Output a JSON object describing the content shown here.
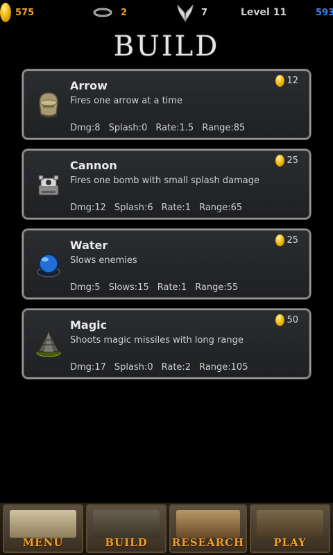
{
  "status": {
    "gold": "575",
    "rings": "2",
    "wings": "7",
    "level": "Level 11",
    "score": "593"
  },
  "page": {
    "title": "BUILD"
  },
  "towers": [
    {
      "name": "Arrow",
      "description": "Fires one arrow at a time",
      "cost": "12",
      "icon": "arrow-tower-icon",
      "stats": [
        "Dmg:8",
        "Splash:0",
        "Rate:1.5",
        "Range:85"
      ]
    },
    {
      "name": "Cannon",
      "description": "Fires one bomb with small splash damage",
      "cost": "25",
      "icon": "cannon-tower-icon",
      "stats": [
        "Dmg:12",
        "Splash:6",
        "Rate:1",
        "Range:65"
      ]
    },
    {
      "name": "Water",
      "description": "Slows enemies",
      "cost": "25",
      "icon": "water-tower-icon",
      "stats": [
        "Dmg:5",
        "Slows:15",
        "Rate:1",
        "Range:55"
      ]
    },
    {
      "name": "Magic",
      "description": "Shoots magic missiles with long range",
      "cost": "50",
      "icon": "magic-tower-icon",
      "stats": [
        "Dmg:17",
        "Splash:0",
        "Rate:2",
        "Range:105"
      ]
    }
  ],
  "nav": {
    "menu": "MENU",
    "build": "BUILD",
    "research": "RESEARCH",
    "play": "PLAY"
  },
  "colors": {
    "gold_text": "#e8a030",
    "score_text": "#3d7fe0",
    "card_border": "#9a9b96",
    "background": "#000000"
  }
}
